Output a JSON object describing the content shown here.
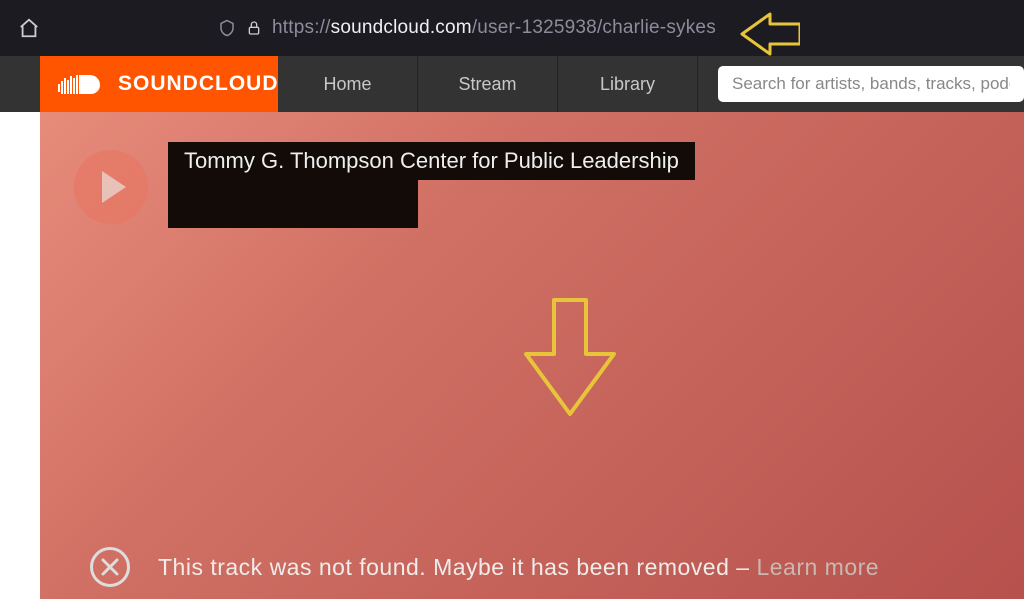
{
  "browser": {
    "url_proto": "https://",
    "url_host": "soundcloud.com",
    "url_path": "/user-1325938/charlie-sykes"
  },
  "brand": {
    "name": "SOUNDCLOUD",
    "accent": "#ff5500"
  },
  "nav": {
    "items": [
      "Home",
      "Stream",
      "Library"
    ]
  },
  "search": {
    "placeholder": "Search for artists, bands, tracks, podcasts"
  },
  "track": {
    "uploader": "Tommy G. Thompson Center for Public Leadership"
  },
  "notfound": {
    "message": "This track was not found. Maybe it has been removed",
    "separator": " – ",
    "learn_more": "Learn more"
  },
  "annotation": {
    "arrow_color": "#e8c43a"
  }
}
